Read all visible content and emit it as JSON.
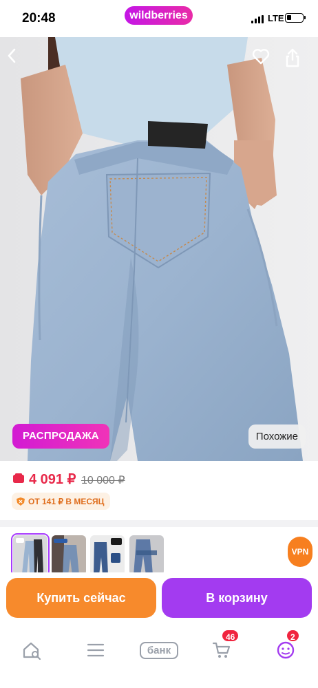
{
  "status_bar": {
    "time": "20:48",
    "brand": "wildberries",
    "network": "LTE"
  },
  "product": {
    "sale_badge": "РАСПРОДАЖА",
    "similar_label": "Похожие",
    "price": "4 091 ₽",
    "old_price": "10 000 ₽",
    "installment": "ОТ 141 ₽ В МЕСЯЦ"
  },
  "thumbnails": [
    "thumb-1",
    "thumb-2",
    "thumb-3",
    "thumb-4"
  ],
  "vpn_label": "VPN",
  "actions": {
    "buy_now": "Купить сейчас",
    "to_cart": "В корзину"
  },
  "tabbar": {
    "bank_label": "банк",
    "cart_count": "46",
    "profile_count": "2"
  },
  "colors": {
    "brand": "#cb11ab",
    "accent": "#a33bf0",
    "buy": "#f78a2c",
    "price": "#e8294a"
  }
}
